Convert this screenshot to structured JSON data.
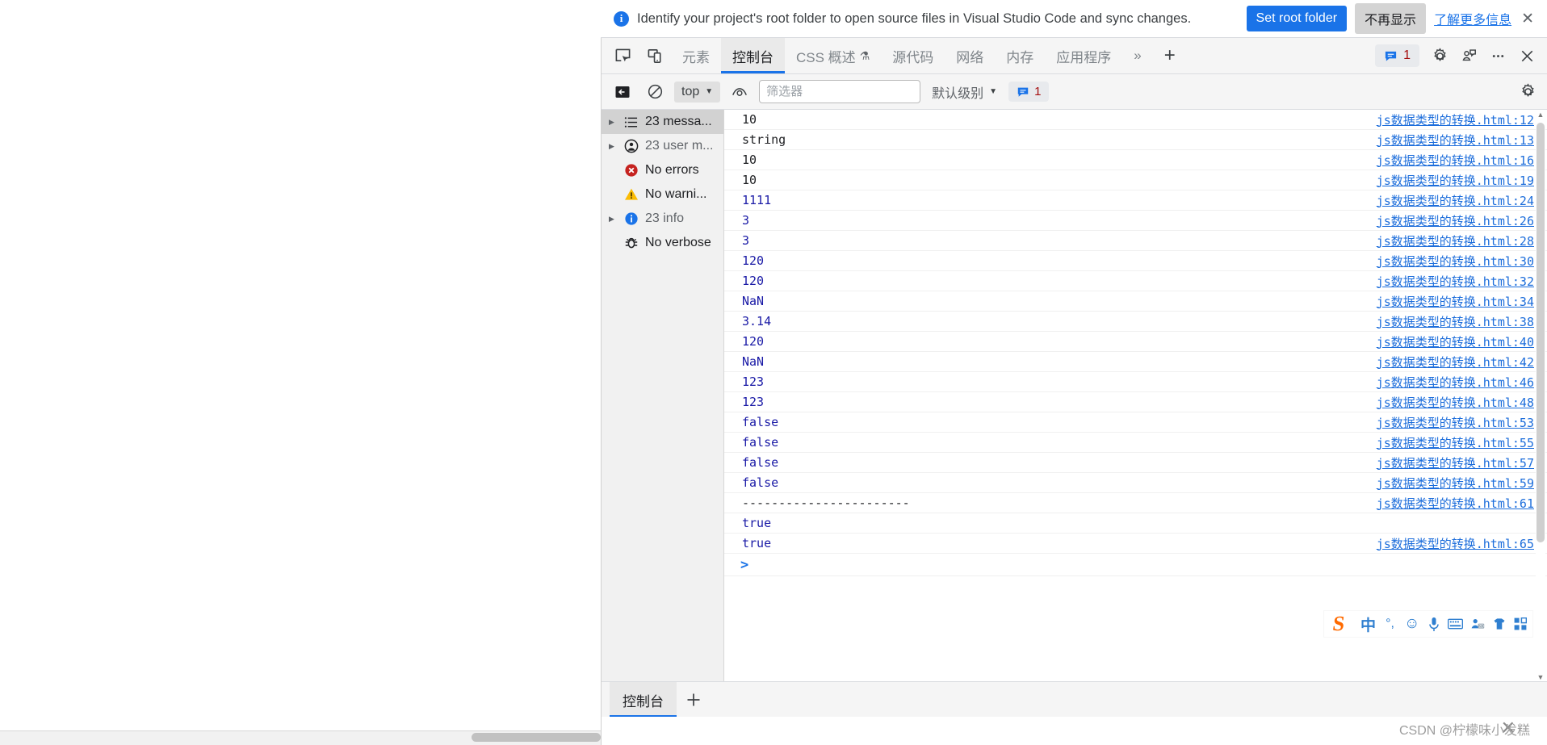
{
  "notification": {
    "icon": "info-icon",
    "message": "Identify your project's root folder to open source files in Visual Studio Code and sync changes.",
    "primary_button": "Set root folder",
    "secondary_button": "不再显示",
    "link": "了解更多信息",
    "close": "✕",
    "accent_color": "#1a73e8"
  },
  "devtools": {
    "tabs": [
      {
        "label": "元素",
        "active": false
      },
      {
        "label": "控制台",
        "active": true
      },
      {
        "label": "CSS 概述",
        "active": false,
        "experimental": true
      },
      {
        "label": "源代码",
        "active": false
      },
      {
        "label": "网络",
        "active": false
      },
      {
        "label": "内存",
        "active": false
      },
      {
        "label": "应用程序",
        "active": false
      }
    ],
    "left_icons": [
      {
        "name": "inspect-element-icon"
      },
      {
        "name": "device-toolbar-icon"
      }
    ],
    "overflow_label": "»",
    "add_tab_label": "+",
    "issues": {
      "count": "1",
      "icon": "issue-bubble-icon"
    },
    "right_icons": [
      {
        "name": "settings-gear-icon"
      },
      {
        "name": "feedback-icon"
      },
      {
        "name": "more-options-icon"
      },
      {
        "name": "close-devtools-icon"
      }
    ],
    "filterbar": {
      "sidebar_toggle": "console-sidebar-toggle-icon",
      "clear_console": "clear-console-icon",
      "context": "top",
      "live_expression": "eye-icon",
      "filter_placeholder": "筛选器",
      "filter_value": "",
      "level": "默认级别",
      "issues_count": "1",
      "settings": "console-settings-gear-icon"
    },
    "sidebar": [
      {
        "label": "23 messa...",
        "icon": "list-icon",
        "expandable": true,
        "selected": true,
        "dim": false
      },
      {
        "label": "23 user m...",
        "icon": "user-message-icon",
        "expandable": true,
        "selected": false,
        "dim": true
      },
      {
        "label": "No errors",
        "icon": "error-icon",
        "expandable": false,
        "selected": false,
        "dim": false
      },
      {
        "label": "No warni...",
        "icon": "warning-icon",
        "expandable": false,
        "selected": false,
        "dim": false
      },
      {
        "label": "23 info",
        "icon": "info-circle-icon",
        "expandable": true,
        "selected": false,
        "dim": true
      },
      {
        "label": "No verbose",
        "icon": "bug-icon",
        "expandable": false,
        "selected": false,
        "dim": false
      }
    ],
    "messages": [
      {
        "value": "10",
        "type": "plain",
        "source": "js数据类型的转换.html:12"
      },
      {
        "value": "string",
        "type": "plain",
        "source": "js数据类型的转换.html:13"
      },
      {
        "value": "10",
        "type": "plain",
        "source": "js数据类型的转换.html:16"
      },
      {
        "value": "10",
        "type": "plain",
        "source": "js数据类型的转换.html:19"
      },
      {
        "value": "1111",
        "type": "num",
        "source": "js数据类型的转换.html:24"
      },
      {
        "value": "3",
        "type": "num",
        "source": "js数据类型的转换.html:26"
      },
      {
        "value": "3",
        "type": "num",
        "source": "js数据类型的转换.html:28"
      },
      {
        "value": "120",
        "type": "num",
        "source": "js数据类型的转换.html:30"
      },
      {
        "value": "120",
        "type": "num",
        "source": "js数据类型的转换.html:32"
      },
      {
        "value": "NaN",
        "type": "num",
        "source": "js数据类型的转换.html:34"
      },
      {
        "value": "3.14",
        "type": "num",
        "source": "js数据类型的转换.html:38"
      },
      {
        "value": "120",
        "type": "num",
        "source": "js数据类型的转换.html:40"
      },
      {
        "value": "NaN",
        "type": "num",
        "source": "js数据类型的转换.html:42"
      },
      {
        "value": "123",
        "type": "num",
        "source": "js数据类型的转换.html:46"
      },
      {
        "value": "123",
        "type": "num",
        "source": "js数据类型的转换.html:48"
      },
      {
        "value": "false",
        "type": "num",
        "source": "js数据类型的转换.html:53"
      },
      {
        "value": "false",
        "type": "num",
        "source": "js数据类型的转换.html:55"
      },
      {
        "value": "false",
        "type": "num",
        "source": "js数据类型的转换.html:57"
      },
      {
        "value": "false",
        "type": "num",
        "source": "js数据类型的转换.html:59"
      },
      {
        "value": "-----------------------",
        "type": "plain",
        "source": "js数据类型的转换.html:61"
      },
      {
        "value": "true",
        "type": "num",
        "source": ""
      },
      {
        "value": "true",
        "type": "num",
        "source": "js数据类型的转换.html:65"
      }
    ],
    "prompt": ">",
    "drawer": {
      "tab": "控制台",
      "add_label": "+"
    }
  },
  "ime": {
    "logo": "S",
    "items": [
      {
        "label": "中",
        "name": "ime-mode-chinese"
      },
      {
        "label": "°,",
        "name": "ime-punctuation"
      },
      {
        "label": "☺",
        "name": "ime-emoji"
      },
      {
        "label": "🎤",
        "name": "ime-voice"
      },
      {
        "label": "⌨",
        "name": "ime-soft-keyboard"
      },
      {
        "label": "",
        "name": "ime-screenshot"
      },
      {
        "label": "",
        "name": "ime-skin"
      },
      {
        "label": "",
        "name": "ime-toolbox"
      }
    ]
  },
  "watermark": "CSDN @柠檬味小发糕"
}
